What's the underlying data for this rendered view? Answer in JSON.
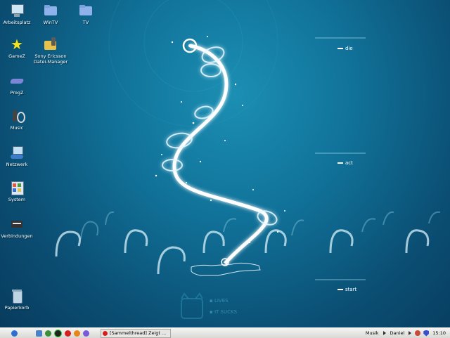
{
  "desktop": {
    "icons": [
      {
        "name": "arbeitsplatz",
        "label": "Arbeitsplatz",
        "icon": "computer-icon"
      },
      {
        "name": "wintv",
        "label": "WinTV",
        "icon": "folder-icon"
      },
      {
        "name": "tv",
        "label": "TV",
        "icon": "folder-icon"
      },
      {
        "name": "gamez",
        "label": "GameZ",
        "icon": "star-icon"
      },
      {
        "name": "sony-ericsson",
        "label": "Sony Ericsson\nDatei-Manager",
        "icon": "phone-folder-icon"
      },
      {
        "name": "progz",
        "label": "ProgZ",
        "icon": "drive-icon"
      },
      {
        "name": "music",
        "label": "Music",
        "icon": "speaker-icon"
      },
      {
        "name": "netzwerk",
        "label": "Netzwerk",
        "icon": "network-icon"
      },
      {
        "name": "system",
        "label": "System",
        "icon": "control-panel-icon"
      },
      {
        "name": "verbindungen",
        "label": "Verbindungen",
        "icon": "connections-icon"
      },
      {
        "name": "papierkorb",
        "label": "Papierkorb",
        "icon": "recycle-bin-icon"
      }
    ]
  },
  "wallpaper": {
    "taglines": [
      "die",
      "act",
      "start"
    ],
    "ghost_lines": [
      "▪ LIVES",
      "▪ IT SUCKS"
    ],
    "colors": {
      "top": "#1c8fb3",
      "bottom": "#073a5c",
      "glow": "#ffffff"
    }
  },
  "taskbar": {
    "quicklaunch": [
      "apple-icon",
      "desktop-icon",
      "globe-icon",
      "opera-icon",
      "firefox-icon",
      "ie-icon",
      "misc-icon"
    ],
    "task_label": "[Sammelthread] Zeigt ...",
    "tray": {
      "music": "Musik",
      "user": "Daniel",
      "time": "15:10"
    }
  }
}
